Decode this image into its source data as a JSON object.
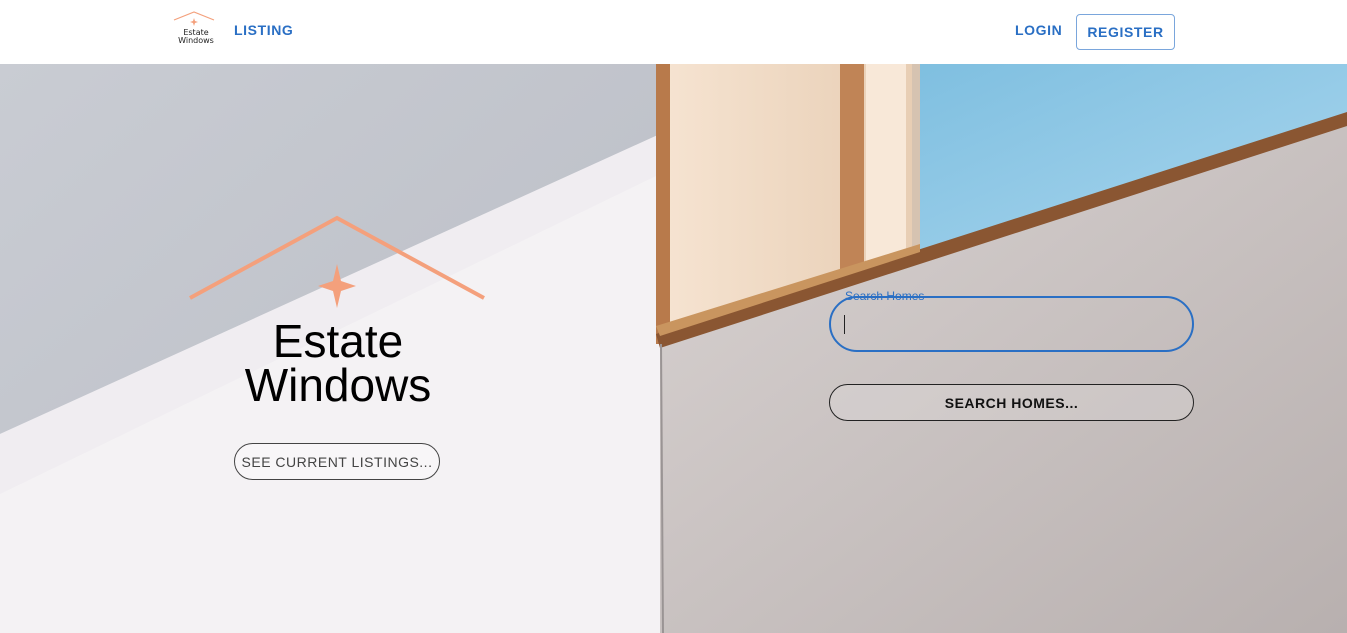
{
  "header": {
    "logo_text_line1": "Estate",
    "logo_text_line2": "Windows",
    "nav_listing": "LISTING",
    "nav_login": "LOGIN",
    "nav_register": "REGISTER"
  },
  "hero": {
    "brand_line1": "Estate",
    "brand_line2": "Windows",
    "see_listings_label": "SEE CURRENT LISTINGS...",
    "search": {
      "label": "Search Homes",
      "value": ""
    },
    "search_button_label": "SEARCH HOMES..."
  },
  "colors": {
    "accent": "#2a6fc4",
    "logo_peach": "#f4a07c"
  },
  "icons": {
    "roof": "roof-icon",
    "sparkle": "sparkle-icon"
  }
}
